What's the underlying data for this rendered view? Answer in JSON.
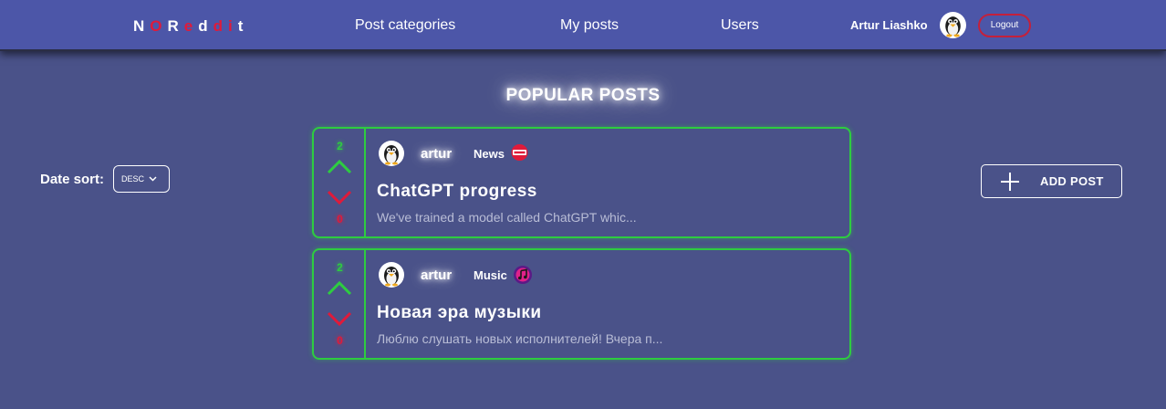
{
  "nav": {
    "logo_letters": [
      "N",
      "O",
      "R",
      "e",
      "d",
      "d",
      "i",
      "t"
    ],
    "links": [
      "Post categories",
      "My posts",
      "Users"
    ],
    "user_name": "Artur Liashko",
    "logout_label": "Logout"
  },
  "colors": {
    "navbar": "#4c56a8",
    "background": "#4a5289",
    "accent_green": "#2ecc40",
    "accent_red": "#e01a3a"
  },
  "page": {
    "heading": "POPULAR POSTS"
  },
  "sort": {
    "label": "Date sort:",
    "value": "DESC"
  },
  "add_post": {
    "label": "ADD POST"
  },
  "posts": [
    {
      "upvotes": "2",
      "downvotes": "0",
      "author": "artur",
      "category": "News",
      "category_icon": "news-icon",
      "title": "ChatGPT progress",
      "excerpt": "We've trained a model called ChatGPT whic..."
    },
    {
      "upvotes": "2",
      "downvotes": "0",
      "author": "artur",
      "category": "Music",
      "category_icon": "music-icon",
      "title": "Новая эра музыки",
      "excerpt": "Люблю слушать новых исполнителей! Вчера п..."
    }
  ]
}
